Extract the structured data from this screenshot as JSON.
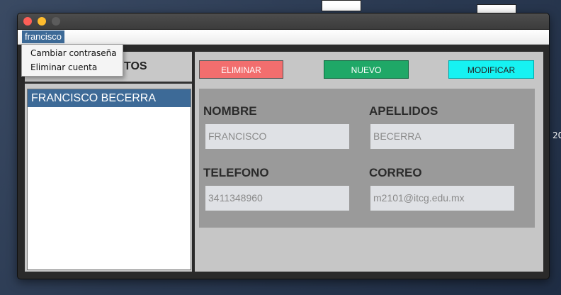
{
  "window": {
    "menu_user": "francisco"
  },
  "menu_dropdown": {
    "items": [
      "Cambiar contraseña",
      "Eliminar cuenta"
    ]
  },
  "left_panel": {
    "header_text": "TOS",
    "list": [
      "FRANCISCO BECERRA"
    ]
  },
  "toolbar": {
    "delete_label": "ELIMINAR",
    "new_label": "NUEVO",
    "modify_label": "MODIFICAR"
  },
  "form": {
    "nombre_label": "NOMBRE",
    "nombre_value": "FRANCISCO",
    "apellidos_label": "APELLIDOS",
    "apellidos_value": "BECERRA",
    "telefono_label": "TELEFONO",
    "telefono_value": "3411348960",
    "correo_label": "CORREO",
    "correo_value": "m2101@itcg.edu.mx"
  },
  "desktop": {
    "right_number": "20"
  },
  "colors": {
    "selection": "#3d6a97",
    "delete_button": "#f26e6e",
    "new_button": "#1fa867",
    "modify_button": "#16f2f2"
  }
}
